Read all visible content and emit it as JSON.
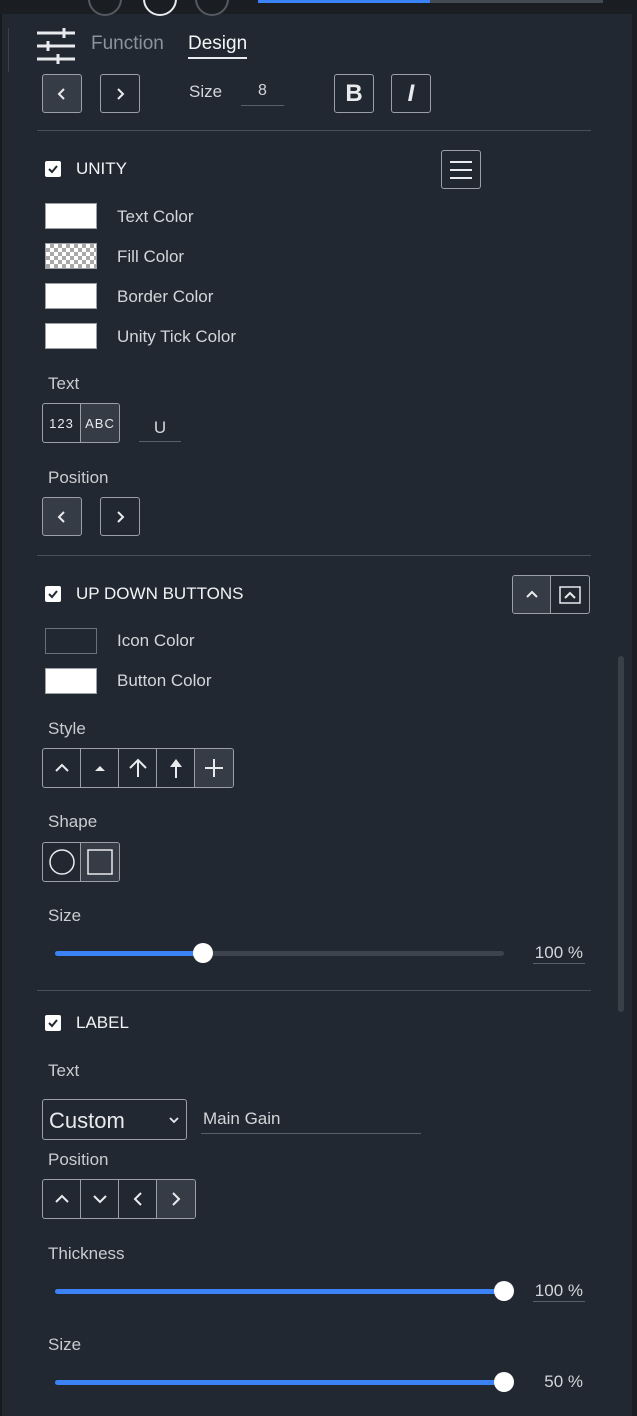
{
  "tabs": {
    "function": "Function",
    "design": "Design"
  },
  "top_row": {
    "size_label": "Size",
    "size_value": "8",
    "bold_label": "B",
    "italic_label": "I"
  },
  "unity": {
    "title": "UNITY",
    "colors": [
      "Text Color",
      "Fill Color",
      "Border Color",
      "Unity Tick Color"
    ],
    "text_label": "Text",
    "text_modes": [
      "123",
      "ABC"
    ],
    "text_value": "U",
    "position_label": "Position"
  },
  "up_down": {
    "title": "UP DOWN BUTTONS",
    "colors": [
      "Icon Color",
      "Button Color"
    ],
    "style_label": "Style",
    "shape_label": "Shape",
    "size_label": "Size",
    "size_value": "100 %",
    "size_fraction": 0.33
  },
  "label": {
    "title": "LABEL",
    "text_label": "Text",
    "text_mode": "Custom",
    "text_value": "Main Gain",
    "position_label": "Position",
    "thickness_label": "Thickness",
    "thickness_value": "100 %",
    "thickness_fraction": 1.0,
    "size_label": "Size",
    "size_value": "50 %",
    "size_fraction": 1.0
  },
  "colors": {
    "background": "#222831",
    "accent": "#3b82f6"
  }
}
